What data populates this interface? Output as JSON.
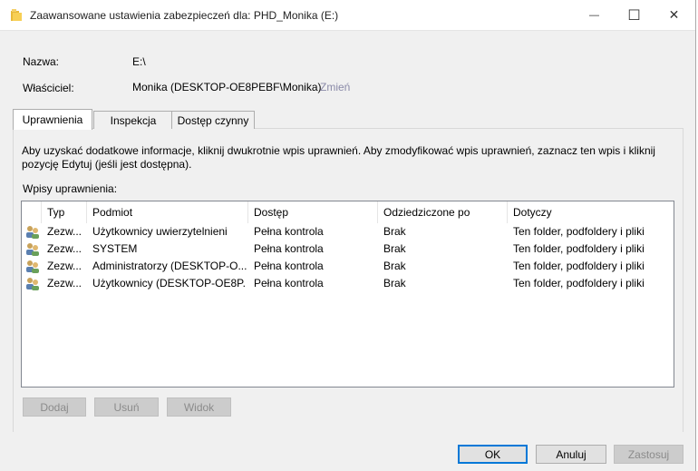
{
  "window": {
    "title": "Zaawansowane ustawienia zabezpieczeń dla: PHD_Monika (E:)",
    "minimize_glyph": "—",
    "maximize_glyph": "☐",
    "close_glyph": "✕"
  },
  "fields": {
    "name_label": "Nazwa:",
    "name_value": "E:\\",
    "owner_label": "Właściciel:",
    "owner_value": "Monika (DESKTOP-OE8PEBF\\Monika)",
    "change_link": "Zmień"
  },
  "tabs": [
    {
      "label": "Uprawnienia",
      "active": true
    },
    {
      "label": "Inspekcja",
      "active": false
    },
    {
      "label": "Dostęp czynny",
      "active": false
    }
  ],
  "info_text": "Aby uzyskać dodatkowe informacje, kliknij dwukrotnie wpis uprawnień. Aby zmodyfikować wpis uprawnień, zaznacz ten wpis i kliknij pozycję Edytuj (jeśli jest dostępna).",
  "permissions": {
    "list_label": "Wpisy uprawnienia:",
    "columns": [
      "Typ",
      "Podmiot",
      "Dostęp",
      "Odziedziczone po",
      "Dotyczy"
    ],
    "rows": [
      {
        "icon": "users-icon",
        "type": "Zezw...",
        "principal": "Użytkownicy uwierzytelnieni",
        "access": "Pełna kontrola",
        "inherited": "Brak",
        "applies": "Ten folder, podfoldery i pliki"
      },
      {
        "icon": "users-icon",
        "type": "Zezw...",
        "principal": "SYSTEM",
        "access": "Pełna kontrola",
        "inherited": "Brak",
        "applies": "Ten folder, podfoldery i pliki"
      },
      {
        "icon": "users-icon",
        "type": "Zezw...",
        "principal": "Administratorzy (DESKTOP-O...",
        "access": "Pełna kontrola",
        "inherited": "Brak",
        "applies": "Ten folder, podfoldery i pliki"
      },
      {
        "icon": "users-icon",
        "type": "Zezw...",
        "principal": "Użytkownicy (DESKTOP-OE8P...",
        "access": "Pełna kontrola",
        "inherited": "Brak",
        "applies": "Ten folder, podfoldery i pliki"
      }
    ]
  },
  "list_buttons": {
    "add": "Dodaj",
    "remove": "Usuń",
    "view": "Widok"
  },
  "dialog_buttons": {
    "ok": "OK",
    "cancel": "Anuluj",
    "apply": "Zastosuj"
  },
  "colors": {
    "accent": "#0078d7",
    "link": "#8a8aa8"
  }
}
